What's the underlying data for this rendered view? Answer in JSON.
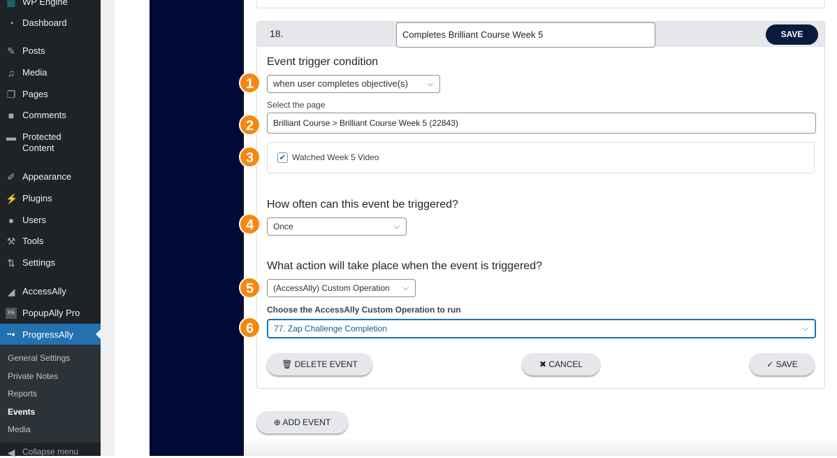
{
  "sidebar": {
    "items": [
      {
        "label": "WP Engine",
        "icon": "wp-engine-icon"
      },
      {
        "label": "Dashboard",
        "icon": "dashboard-icon"
      },
      {
        "label": "Posts",
        "icon": "pin-icon"
      },
      {
        "label": "Media",
        "icon": "media-icon"
      },
      {
        "label": "Pages",
        "icon": "pages-icon"
      },
      {
        "label": "Comments",
        "icon": "comment-icon"
      },
      {
        "label": "Protected Content",
        "icon": "folder-lock-icon"
      },
      {
        "label": "Appearance",
        "icon": "brush-icon"
      },
      {
        "label": "Plugins",
        "icon": "plug-icon"
      },
      {
        "label": "Users",
        "icon": "user-icon"
      },
      {
        "label": "Tools",
        "icon": "wrench-icon"
      },
      {
        "label": "Settings",
        "icon": "settings-icon"
      },
      {
        "label": "AccessAlly",
        "icon": "accessally-icon"
      },
      {
        "label": "PopupAlly Pro",
        "icon": "popupally-icon"
      },
      {
        "label": "ProgressAlly",
        "icon": "progressally-icon"
      }
    ],
    "submenu": [
      "General Settings",
      "Private Notes",
      "Reports",
      "Events",
      "Media"
    ],
    "active_sub": "Events",
    "collapse": "Collapse menu"
  },
  "event": {
    "number": "18.",
    "name": "Completes Brilliant Course Week 5",
    "save_top": "SAVE",
    "trigger_heading": "Event trigger condition",
    "trigger_value": "when user completes objective(s)",
    "page_label": "Select the page",
    "page_value": "Brilliant Course > Brilliant Course Week 5 (22843)",
    "objective_label": "Watched Week 5 Video",
    "objective_checked": true,
    "frequency_heading": "How often can this event be triggered?",
    "frequency_value": "Once",
    "action_heading": "What action will take place when the event is triggered?",
    "action_value": "(AccessAlly) Custom Operation",
    "operation_label": "Choose the AccessAlly Custom Operation to run",
    "operation_value": "77. Zap Challenge Completion",
    "delete": "DELETE EVENT",
    "cancel": "CANCEL",
    "save": "SAVE"
  },
  "add_event": "ADD EVENT",
  "badges": [
    "1",
    "2",
    "3",
    "4",
    "5",
    "6"
  ],
  "colors": {
    "badge": "#f7870f",
    "active": "#2271b1",
    "sidebar": "#1d2327",
    "navy": "#000b35",
    "save_top": "#0a1a3d"
  }
}
